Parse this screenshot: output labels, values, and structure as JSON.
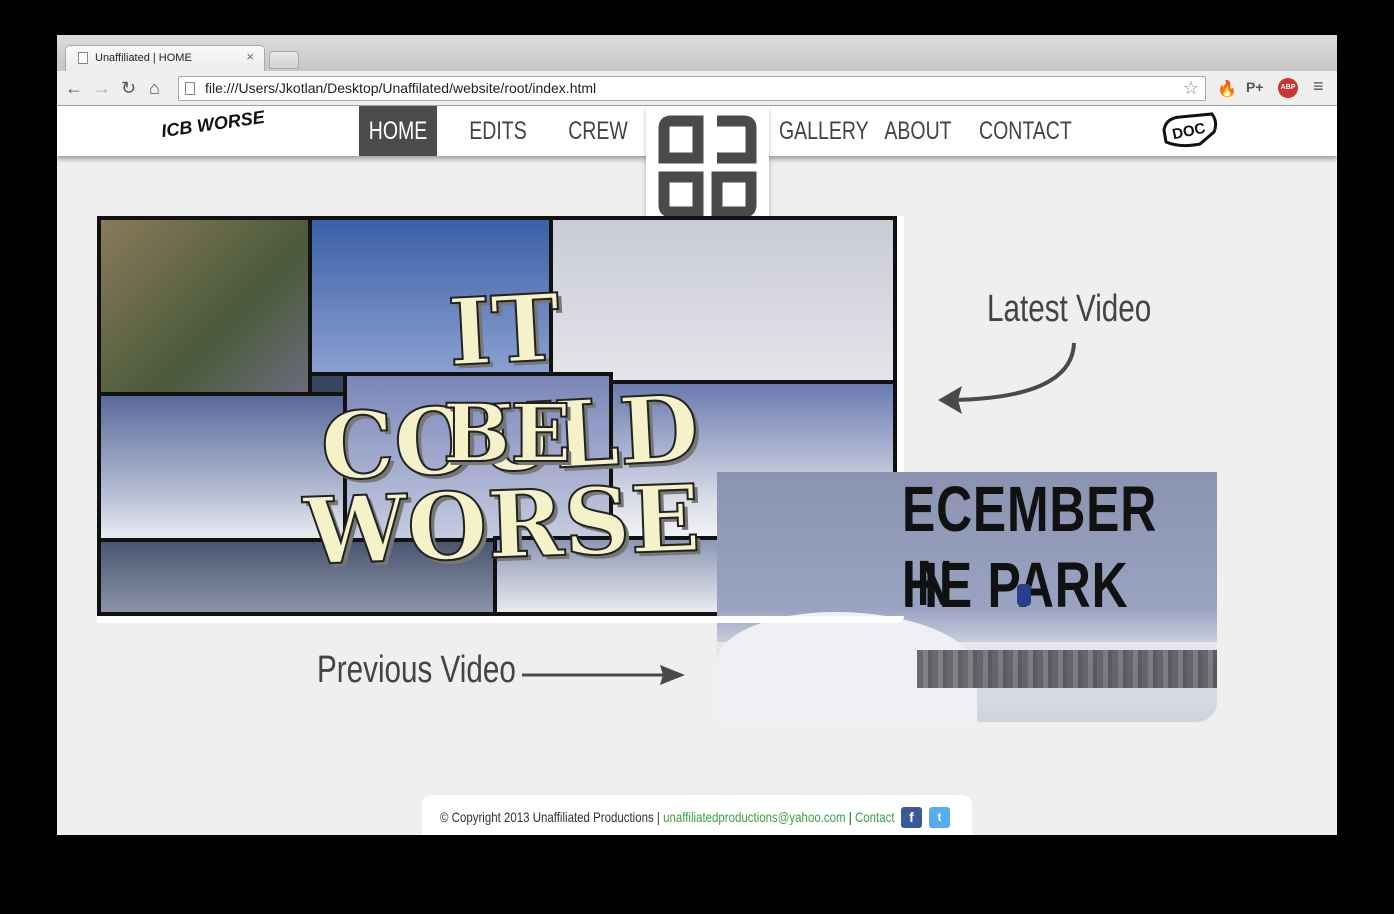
{
  "browser": {
    "tab_title": "Unaffiliated | HOME",
    "url": "file:///Users/Jkotlan/Desktop/Unaffilated/website/root/index.html",
    "extensions": [
      "flame-icon",
      "P+",
      "ABP",
      "menu-icon"
    ]
  },
  "header": {
    "left_logo_text": "ICB WORSE",
    "nav": [
      {
        "label": "HOME",
        "active": true
      },
      {
        "label": "EDITS",
        "active": false
      },
      {
        "label": "CREW",
        "active": false
      },
      {
        "label": "GALLERY",
        "active": false
      },
      {
        "label": "ABOUT",
        "active": false
      },
      {
        "label": "CONTACT",
        "active": false
      }
    ],
    "right_logo_text": "DOC"
  },
  "main": {
    "latest_label": "Latest Video",
    "previous_label": "Previous Video",
    "latest_video": {
      "line1": "IT COULD",
      "line2": "BE",
      "line3": "WORSE"
    },
    "previous_video": {
      "line1": "ECEMBER IN",
      "line2": "HE PARK"
    }
  },
  "footer": {
    "copyright": "© Copyright 2013 Unaffiliated Productions",
    "email": "unaffiliatedproductions@yahoo.com",
    "contact": "Contact",
    "separator": "|"
  },
  "colors": {
    "accent": "#3aa344",
    "nav_active": "#4b4b4b",
    "facebook": "#3b5998",
    "twitter": "#55acee"
  }
}
